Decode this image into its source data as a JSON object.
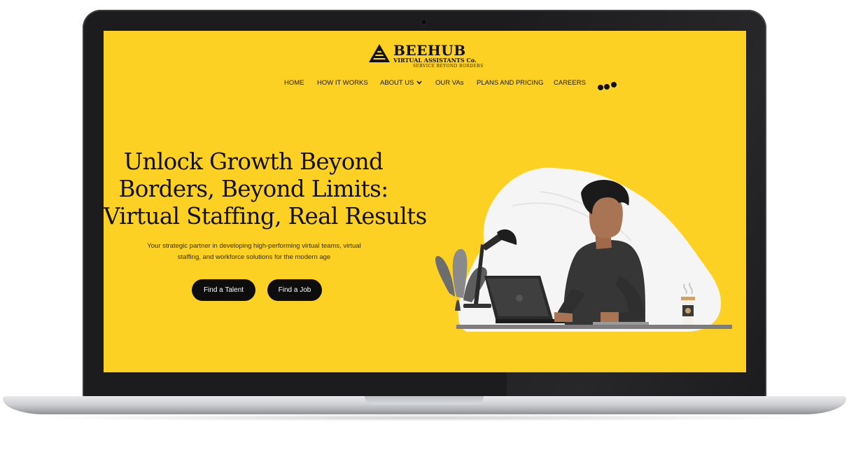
{
  "brand": {
    "name": "BEEHUB",
    "subtitle": "VIRTUAL ASSISTANTS Co.",
    "tagline": "SERVICE BEYOND BORDERS"
  },
  "nav": {
    "items": [
      {
        "label": "HOME"
      },
      {
        "label": "HOW IT WORKS"
      },
      {
        "label": "ABOUT US"
      },
      {
        "label": "OUR VAs"
      },
      {
        "label": "PLANS AND PRICING"
      },
      {
        "label": "CAREERS"
      }
    ],
    "more_icon": "more-dots-icon",
    "dropdown_icon": "chevron-down-icon"
  },
  "hero": {
    "title_lines": [
      "Unlock Growth Beyond",
      "Borders, Beyond Limits:",
      "Virtual Staffing, Real Results"
    ],
    "subtitle": "Your strategic partner in developing high-performing virtual teams, virtual staffing, and workforce solutions for the modern age",
    "buttons": {
      "talent": "Find a Talent",
      "job": "Find a Job"
    }
  },
  "colors": {
    "background": "#fdd024",
    "button": "#0d0d0d",
    "text": "#111111"
  }
}
